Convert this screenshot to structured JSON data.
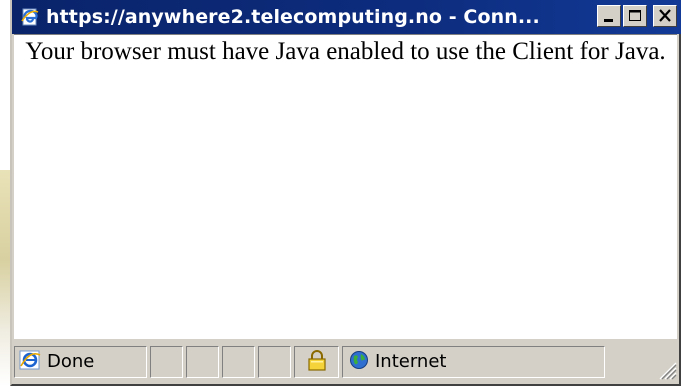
{
  "window": {
    "title": "https://anywhere2.telecomputing.no - Conn..."
  },
  "content": {
    "message": "Your browser must have Java enabled to use the Client for Java."
  },
  "statusbar": {
    "status": "Done",
    "zone": "Internet"
  },
  "icons": {
    "title": "ie-page-icon",
    "status": "ie-logo-icon",
    "secure": "padlock-icon",
    "zone": "globe-icon"
  }
}
